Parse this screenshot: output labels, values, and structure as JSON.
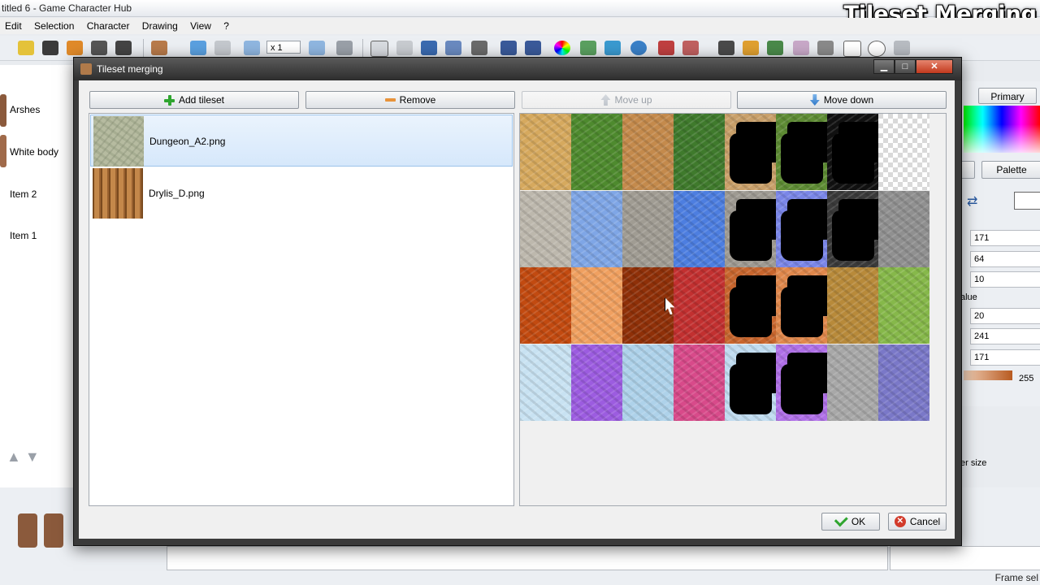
{
  "app": {
    "title": "titled 6 - Game Character Hub",
    "overlay_caption": "Tileset Merging",
    "menu": [
      "Edit",
      "Selection",
      "Character",
      "Drawing",
      "View",
      "?"
    ],
    "zoom": "x 1"
  },
  "left_panel": {
    "items": [
      "Arshes",
      "White body",
      "Item 2",
      "Item 1"
    ]
  },
  "right_panel": {
    "primary_color_label": "Primary color",
    "palette_label": "Palette",
    "values": [
      "171",
      "64",
      "10",
      "20",
      "241",
      "171"
    ],
    "value_caption": "alue",
    "alpha": "255",
    "size_caption": "er size"
  },
  "status": {
    "frame_sel": "Frame sel"
  },
  "dialog": {
    "title": "Tileset merging",
    "buttons": {
      "add": "Add tileset",
      "remove": "Remove",
      "move_up": "Move up",
      "move_down": "Move down",
      "ok": "OK",
      "cancel": "Cancel"
    },
    "tilesets": [
      {
        "name": "Dungeon_A2.png",
        "selected": true
      },
      {
        "name": "Drylis_D.png",
        "selected": false
      }
    ],
    "tile_colors": [
      [
        "#d6a95e",
        "#4e8a2e",
        "#c48a4c",
        "#3f7a2c",
        "#c9a06a",
        "#5e8c34",
        "#111111",
        "checker"
      ],
      [
        "#bdb8ad",
        "#7fa6e6",
        "#a09c93",
        "#4d7ee0",
        "#9e9a92",
        "#7a86e8",
        "#3a3a3a",
        "#909090"
      ],
      [
        "#c24a10",
        "#f0a060",
        "#8f3008",
        "#c23030",
        "#c8662e",
        "#e0884c",
        "#b88a3a",
        "#86b84a"
      ],
      [
        "#c8e2f2",
        "#9c5ce0",
        "#aed2ea",
        "#d84a8a",
        "#c0dcf0",
        "#b070e8",
        "#a8a8a8",
        "#7a78c8"
      ]
    ],
    "tile_holes": [
      [
        false,
        false,
        false,
        false,
        true,
        true,
        true,
        false
      ],
      [
        false,
        false,
        false,
        false,
        true,
        true,
        true,
        false
      ],
      [
        false,
        false,
        false,
        false,
        true,
        true,
        false,
        false
      ],
      [
        false,
        false,
        false,
        false,
        true,
        true,
        false,
        false
      ]
    ]
  }
}
